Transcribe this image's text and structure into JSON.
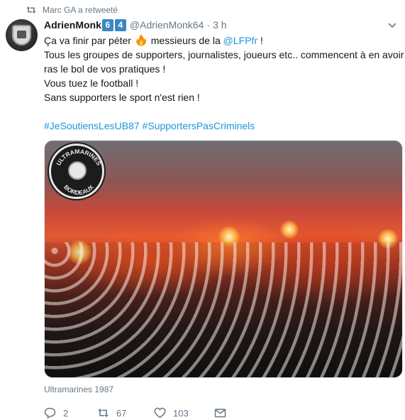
{
  "retweet_context": {
    "text": "Marc GA a retweeté",
    "icon": "retweet-icon"
  },
  "author": {
    "display_name": "AdrienMonk",
    "badge_digits": [
      "6",
      "4"
    ],
    "handle": "@AdrienMonk64",
    "separator": "·",
    "time": "3 h"
  },
  "tweet": {
    "line1_before": "Ça va finir par péter ",
    "line1_middle": " messieurs de la ",
    "line1_mention": "@LFPfr",
    "line1_after": " !",
    "line2": "Tous les groupes de supporters, journalistes, joueurs etc.. commencent à en avoir",
    "line3": "ras le bol de vos pratiques !",
    "line4": "Vous tuez le football !",
    "line5": "Sans supporters le sport n'est rien !",
    "hashtag1": "#JeSoutiensLesUB87",
    "hashtag2": "#SupportersPasCriminels"
  },
  "media": {
    "logo_top": "ULTRAMARINES",
    "logo_bottom": "BORDEAUX",
    "caption": "Ultramarines 1987"
  },
  "actions": {
    "reply_count": "2",
    "retweet_count": "67",
    "like_count": "103"
  },
  "colors": {
    "link": "#1b95e0",
    "secondary": "#657786",
    "badge": "#3b88c3"
  }
}
